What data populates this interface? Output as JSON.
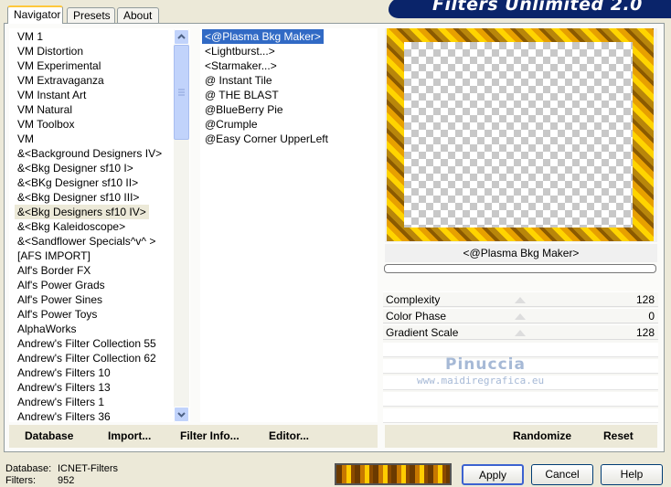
{
  "banner": {
    "title": "Filters Unlimited 2.0"
  },
  "tabs": [
    {
      "label": "Navigator",
      "active": true
    },
    {
      "label": "Presets",
      "active": false
    },
    {
      "label": "About",
      "active": false
    }
  ],
  "categories": [
    "VM 1",
    "VM Distortion",
    "VM Experimental",
    "VM Extravaganza",
    "VM Instant Art",
    "VM Natural",
    "VM Toolbox",
    "VM",
    "&<Background Designers IV>",
    "&<Bkg Designer sf10 I>",
    "&<BKg Designer sf10 II>",
    "&<Bkg Designer sf10 III>",
    "&<Bkg Designers sf10 IV>",
    "&<Bkg Kaleidoscope>",
    "&<Sandflower Specials^v^ >",
    "[AFS IMPORT]",
    "Alf's Border FX",
    "Alf's Power Grads",
    "Alf's Power Sines",
    "Alf's Power Toys",
    "AlphaWorks",
    "Andrew's Filter Collection 55",
    "Andrew's Filter Collection 62",
    "Andrew's Filters 10",
    "Andrew's Filters 13",
    "Andrew's Filters 1",
    "Andrew's Filters 36"
  ],
  "selected_category": "&<Bkg Designers sf10 IV>",
  "filters": [
    "<@Plasma Bkg Maker>",
    "<Lightburst...>",
    "<Starmaker...>",
    "@ Instant Tile",
    "@ THE BLAST",
    "@BlueBerry Pie",
    "@Crumple",
    "@Easy Corner UpperLeft"
  ],
  "selected_filter": "<@Plasma Bkg Maker>",
  "preview_filter_name": "<@Plasma Bkg Maker>",
  "params": [
    {
      "label": "Complexity",
      "value": "128"
    },
    {
      "label": "Color Phase",
      "value": "0"
    },
    {
      "label": "Gradient Scale",
      "value": "128"
    }
  ],
  "watermark": {
    "name": "Pinuccia",
    "url": "www.maidiregrafica.eu"
  },
  "left_buttons": {
    "database": "Database",
    "import": "Import...",
    "filter_info": "Filter Info...",
    "editor": "Editor..."
  },
  "right_buttons": {
    "randomize": "Randomize",
    "reset": "Reset"
  },
  "status": {
    "database_label": "Database:",
    "database_value": "ICNET-Filters",
    "filters_label": "Filters:",
    "filters_value": "952"
  },
  "dialog_buttons": {
    "apply": "Apply",
    "cancel": "Cancel",
    "help": "Help"
  }
}
